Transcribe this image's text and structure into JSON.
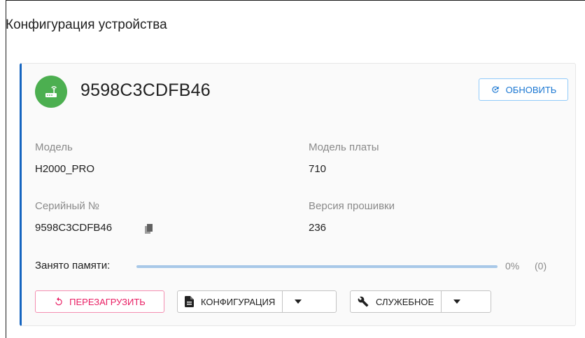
{
  "page": {
    "title": "Конфигурация устройства"
  },
  "device": {
    "name": "9598C3CDFB46",
    "avatar_icon": "router-icon",
    "avatar_color": "#4caf50",
    "refresh_label": "ОБНОВИТЬ"
  },
  "fields": {
    "model_label": "Модель",
    "model_value": "H2000_PRO",
    "board_label": "Модель платы",
    "board_value": "710",
    "serial_label": "Серийный №",
    "serial_value": "9598C3CDFB46",
    "firmware_label": "Версия прошивки",
    "firmware_value": "236"
  },
  "memory": {
    "label": "Занято памяти:",
    "fraction": 0,
    "percent_text": "0%",
    "count_text": "(0)"
  },
  "actions": {
    "reboot_label": "ПЕРЕЗАГРУЗИТЬ",
    "config_label": "КОНФИГУРАЦИЯ",
    "service_label": "СЛУЖЕБНОЕ"
  },
  "colors": {
    "accent": "#1976d2",
    "card_border": "#1565c0",
    "danger": "#e91e63"
  }
}
